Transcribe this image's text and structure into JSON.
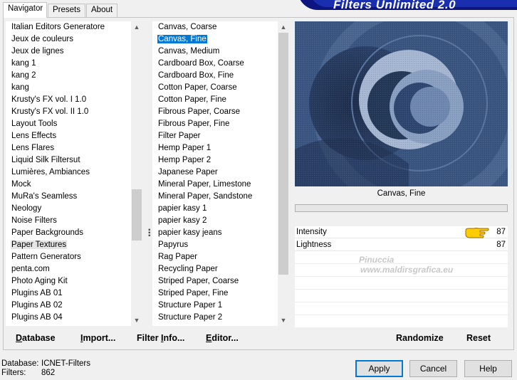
{
  "tabs": [
    "Navigator",
    "Presets",
    "About"
  ],
  "banner": "Filters Unlimited 2.0",
  "categories": [
    "Italian Editors Generatore",
    "Jeux de couleurs",
    "Jeux de lignes",
    "kang 1",
    "kang 2",
    "kang",
    "Krusty's FX vol. I 1.0",
    "Krusty's FX vol. II 1.0",
    "Layout Tools",
    "Lens Effects",
    "Lens Flares",
    "Liquid Silk Filtersut",
    "Lumières, Ambiances",
    "Mock",
    "MuRa's Seamless",
    "Neology",
    "Noise Filters",
    "Paper Backgrounds",
    "Paper Textures",
    "Pattern Generators",
    "penta.com",
    "Photo Aging Kit",
    "Plugins AB 01",
    "Plugins AB 02",
    "Plugins AB 04"
  ],
  "categories_selected_index": 18,
  "filters": [
    "Canvas, Coarse",
    "Canvas, Fine",
    "Canvas, Medium",
    "Cardboard Box, Coarse",
    "Cardboard Box, Fine",
    "Cotton Paper, Coarse",
    "Cotton Paper, Fine",
    "Fibrous Paper, Coarse",
    "Fibrous Paper, Fine",
    "Filter Paper",
    "Hemp Paper 1",
    "Hemp Paper 2",
    "Japanese Paper",
    "Mineral Paper, Limestone",
    "Mineral Paper, Sandstone",
    "papier kasy 1",
    "papier kasy 2",
    "papier kasy jeans",
    "Papyrus",
    "Rag Paper",
    "Recycling Paper",
    "Striped Paper, Coarse",
    "Striped Paper, Fine",
    "Structure Paper 1",
    "Structure Paper 2"
  ],
  "filters_selected_index": 1,
  "preview_label": "Canvas, Fine",
  "params": [
    {
      "name": "Intensity",
      "value": "87"
    },
    {
      "name": "Lightness",
      "value": "87"
    }
  ],
  "watermark": {
    "line1": "Pinuccia",
    "line2": "www.maldirsgrafica.eu"
  },
  "left_buttons": {
    "database": {
      "u": "D",
      "rest": "atabase"
    },
    "import": {
      "u": "I",
      "rest": "mport..."
    },
    "filter_info": {
      "pre": "Filter ",
      "u": "I",
      "rest": "nfo..."
    },
    "editor": {
      "u": "E",
      "rest": "ditor..."
    }
  },
  "right_buttons": {
    "randomize": "Randomize",
    "reset": "Reset"
  },
  "status": {
    "database_label": "Database:",
    "database_value": "ICNET-Filters",
    "filters_label": "Filters:",
    "filters_value": "862"
  },
  "dialog_buttons": {
    "apply": "Apply",
    "cancel": "Cancel",
    "help": "Help"
  },
  "colors": {
    "selection": "#0078d7",
    "banner": "#1a2fb0",
    "preview_bg": "#35507a"
  }
}
